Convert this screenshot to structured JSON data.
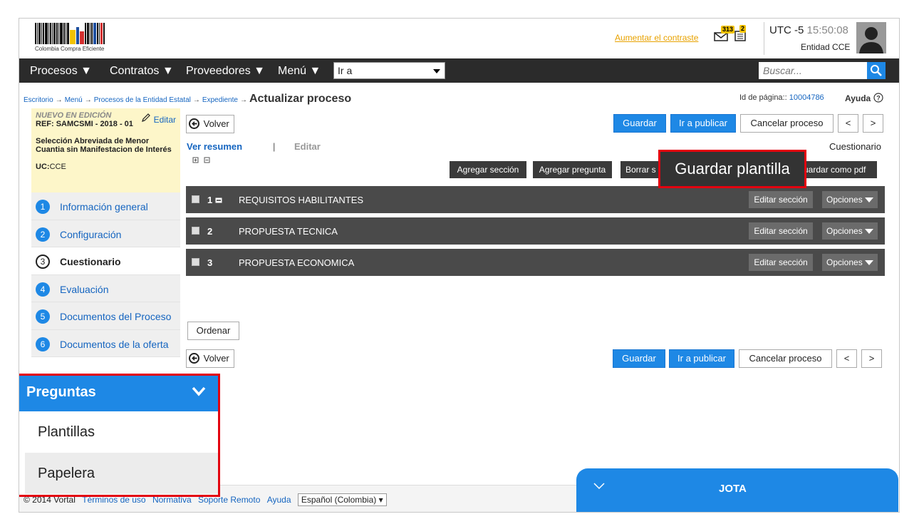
{
  "header": {
    "logo_text": "Colombia Compra Eficiente",
    "contrast_link": "Aumentar el contraste",
    "mail_count": "313",
    "doc_count": "2",
    "utc_label": "UTC -5",
    "time": "15:50:08",
    "entity": "Entidad CCE"
  },
  "nav": {
    "items": [
      "Procesos ▼",
      "Contratos ▼",
      "Proveedores ▼",
      "Menú ▼"
    ],
    "goto_value": "Ir a",
    "search_placeholder": "Buscar..."
  },
  "breadcrumb": {
    "items": [
      "Escritorio",
      "Menú",
      "Procesos de la Entidad Estatal",
      "Expediente"
    ],
    "current": "Actualizar proceso",
    "arrow": "→"
  },
  "page": {
    "id_label": "Id de página::",
    "id_value": "10004786",
    "help": "Ayuda"
  },
  "process": {
    "status": "NUEVO EN EDICIÓN",
    "edit": "Editar",
    "ref": "REF: SAMCSMI - 2018 - 01",
    "description": "Selección Abreviada de Menor Cuantia sin Manifestacion de Interés",
    "uc_label": "UC:",
    "uc_value": "CCE"
  },
  "steps": [
    {
      "n": "1",
      "label": "Información general"
    },
    {
      "n": "2",
      "label": "Configuración"
    },
    {
      "n": "3",
      "label": "Cuestionario"
    },
    {
      "n": "4",
      "label": "Evaluación"
    },
    {
      "n": "5",
      "label": "Documentos del Proceso"
    },
    {
      "n": "6",
      "label": "Documentos de la oferta"
    }
  ],
  "actions": {
    "back": "Volver",
    "save": "Guardar",
    "publish": "Ir a publicar",
    "cancel": "Cancelar proceso",
    "prev": "<",
    "next": ">",
    "order": "Ordenar"
  },
  "tabs": {
    "summary": "Ver resumen",
    "sep": "|",
    "edit": "Editar",
    "right_label": "Cuestionario"
  },
  "toolbar": {
    "add_section": "Agregar sección",
    "add_question": "Agregar pregunta",
    "delete": "Borrar s",
    "save_pdf": "uardar como pdf"
  },
  "sections": [
    {
      "num": "1",
      "title": "REQUISITOS HABILITANTES",
      "edit": "Editar sección",
      "options": "Opciones"
    },
    {
      "num": "2",
      "title": "PROPUESTA TECNICA",
      "edit": "Editar sección",
      "options": "Opciones"
    },
    {
      "num": "3",
      "title": "PROPUESTA ECONOMICA",
      "edit": "Editar sección",
      "options": "Opciones"
    }
  ],
  "tooltip": "Guardar plantilla",
  "dropdown": {
    "title": "Preguntas",
    "items": [
      "Plantillas",
      "Papelera"
    ]
  },
  "footer": {
    "copyright": "© 2014 Vortal",
    "links": [
      "Términos de uso",
      "Normativa",
      "Soporte Remoto",
      "Ayuda"
    ],
    "language": "Español (Colombia) ▾"
  },
  "chat": {
    "title": "JOTA"
  },
  "colors": {
    "accent": "#1e88e5",
    "highlight": "#e3000f",
    "nav_bg": "#2b2b2b",
    "section_bg": "#4a4a4a"
  }
}
